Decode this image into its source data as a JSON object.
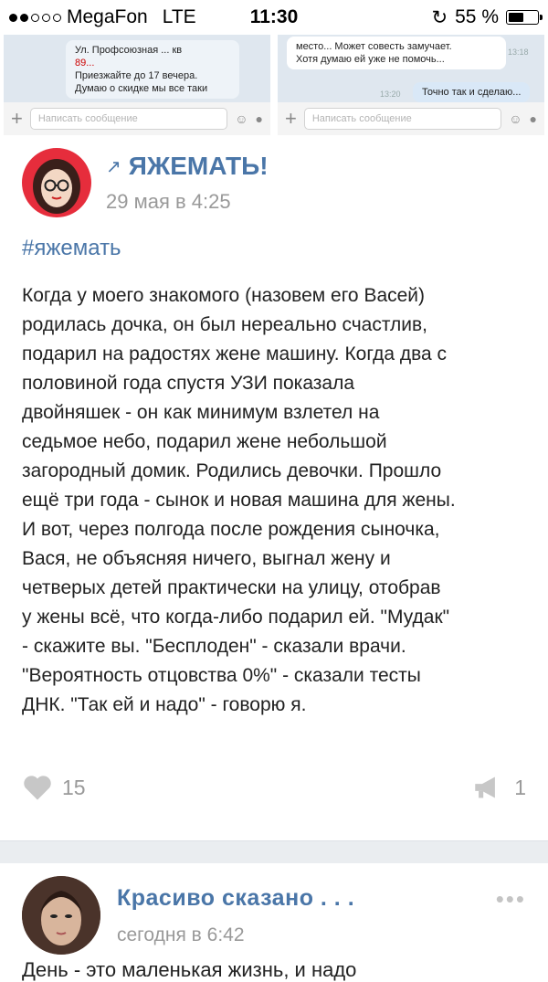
{
  "statusbar": {
    "carrier": "MegaFon",
    "network": "LTE",
    "time": "11:30",
    "battery": "55 %",
    "battery_level": 0.55
  },
  "chat_left": {
    "msg_lines": [
      "Ул. Профсоюзная ... кв",
      "89...",
      "Приезжайте до 17 вечера.",
      "Думаю о скидке мы все таки"
    ],
    "input_placeholder": "Написать сообщение"
  },
  "chat_right": {
    "msg_lines": [
      "место... Может совесть замучает.",
      "Хотя думаю ей уже не помочь..."
    ],
    "msg_time": "13:18",
    "reply": "Точно так и сделаю...",
    "reply_time": "13:20",
    "input_placeholder": "Написать сообщение"
  },
  "post": {
    "group_name": "ЯЖЕМАТЬ!",
    "date": "29 мая в 4:25",
    "hashtag": "#яжемать",
    "text": "Когда у моего знакомого (назовем его Васей)\nродилась дочка, он был нереально счастлив,\nподарил на радостях жене машину. Когда два с\nполовиной года спустя УЗИ показала\nдвойняшек - он как минимум взлетел на\nседьмое небо, подарил жене небольшой\nзагородный домик. Родились девочки. Прошло\nещё три года - сынок и новая машина для жены.\nИ вот, через полгода после рождения сыночка,\nВася, не объясняя ничего, выгнал жену и\nчетверых детей практически на улицу, отобрав\nу жены всё, что когда-либо подарил ей. \"Мудак\"\n- скажите вы. \"Бесплоден\" - сказали врачи.\n\"Вероятность отцовства 0%\" - сказали тесты\nДНК. \"Так ей и надо\" - говорю я.",
    "likes": "15",
    "shares": "1"
  },
  "post2": {
    "group_name": "Красиво сказано . . .",
    "date": "сегодня в 6:42",
    "text_cut": "День - это маленькая жизнь, и надо"
  }
}
